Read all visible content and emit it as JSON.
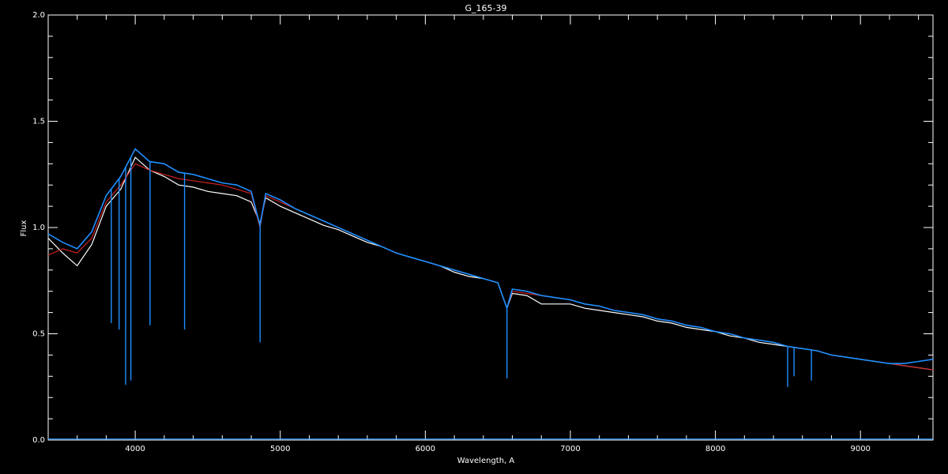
{
  "chart_data": {
    "type": "line",
    "title": "G_165-39",
    "xlabel": "Wavelength, A",
    "ylabel": "Flux",
    "xlim": [
      3400,
      9500
    ],
    "ylim": [
      0,
      2.0
    ],
    "xticks": [
      4000,
      5000,
      6000,
      7000,
      8000,
      9000
    ],
    "yticks": [
      0.0,
      0.5,
      1.0,
      1.5,
      2.0
    ],
    "ytick_labels": [
      "0.0",
      "0.5",
      "1.0",
      "1.5",
      "2.0"
    ],
    "grid": false,
    "background": "#000000",
    "axis_color": "#ffffff",
    "series": [
      {
        "color": "#ffffff",
        "x": [
          3400,
          3500,
          3600,
          3700,
          3800,
          3900,
          4000,
          4100,
          4200,
          4300,
          4400,
          4500,
          4600,
          4700,
          4800,
          4860,
          4900,
          5000,
          5100,
          5200,
          5300,
          5400,
          5500,
          5600,
          5700,
          5800,
          5900,
          6000,
          6100,
          6200,
          6300,
          6400,
          6500,
          6563,
          6600,
          6700,
          6800,
          6900,
          7000,
          7100,
          7200,
          7300,
          7400,
          7500,
          7600,
          7700,
          7800,
          7900,
          8000,
          8100,
          8200,
          8300,
          8400,
          8500,
          8600,
          8700,
          8800,
          8900,
          9000,
          9100,
          9200,
          9300,
          9400,
          9500
        ],
        "y": [
          0.95,
          0.88,
          0.82,
          0.92,
          1.1,
          1.18,
          1.33,
          1.27,
          1.24,
          1.2,
          1.19,
          1.17,
          1.16,
          1.15,
          1.12,
          1.02,
          1.14,
          1.1,
          1.07,
          1.04,
          1.01,
          0.99,
          0.96,
          0.93,
          0.91,
          0.88,
          0.86,
          0.84,
          0.82,
          0.79,
          0.77,
          0.76,
          0.74,
          0.62,
          0.69,
          0.68,
          0.64,
          0.64,
          0.64,
          0.62,
          0.61,
          0.6,
          0.59,
          0.58,
          0.56,
          0.55,
          0.53,
          0.52,
          0.51,
          0.49,
          0.48,
          0.46,
          0.45,
          0.44,
          0.43,
          0.42,
          0.4,
          0.39,
          0.38,
          0.37,
          0.36,
          0.35,
          0.34,
          0.33
        ]
      },
      {
        "color": "#cc2222",
        "x": [
          3400,
          3500,
          3600,
          3700,
          3800,
          3900,
          4000,
          4100,
          4200,
          4300,
          4400,
          4500,
          4600,
          4700,
          4800,
          4860,
          4900,
          5000,
          5100,
          5200,
          5300,
          5400,
          5500,
          5600,
          5700,
          5800,
          5900,
          6000,
          6100,
          6200,
          6300,
          6400,
          6500,
          6563,
          6600,
          6700,
          6800,
          6900,
          7000,
          7100,
          7200,
          7300,
          7400,
          7500,
          7600,
          7700,
          7800,
          7900,
          8000,
          8100,
          8200,
          8300,
          8400,
          8500,
          8600,
          8700,
          8800,
          8900,
          9000,
          9100,
          9200,
          9300,
          9400,
          9500
        ],
        "y": [
          0.87,
          0.9,
          0.88,
          0.95,
          1.12,
          1.2,
          1.3,
          1.27,
          1.25,
          1.23,
          1.22,
          1.21,
          1.2,
          1.18,
          1.16,
          1.0,
          1.15,
          1.12,
          1.09,
          1.06,
          1.03,
          1.0,
          0.97,
          0.94,
          0.91,
          0.88,
          0.86,
          0.84,
          0.82,
          0.8,
          0.78,
          0.76,
          0.74,
          0.62,
          0.7,
          0.69,
          0.68,
          0.67,
          0.66,
          0.64,
          0.63,
          0.61,
          0.6,
          0.59,
          0.57,
          0.56,
          0.54,
          0.53,
          0.51,
          0.5,
          0.48,
          0.47,
          0.46,
          0.44,
          0.43,
          0.42,
          0.4,
          0.39,
          0.38,
          0.37,
          0.36,
          0.35,
          0.34,
          0.33
        ]
      },
      {
        "color": "#1e8fff",
        "x": [
          3400,
          3500,
          3600,
          3700,
          3800,
          3900,
          4000,
          4100,
          4200,
          4300,
          4400,
          4500,
          4600,
          4700,
          4800,
          4860,
          4900,
          5000,
          5100,
          5200,
          5300,
          5400,
          5500,
          5600,
          5700,
          5800,
          5900,
          6000,
          6100,
          6200,
          6300,
          6400,
          6500,
          6563,
          6600,
          6700,
          6800,
          6900,
          7000,
          7100,
          7200,
          7300,
          7400,
          7500,
          7600,
          7700,
          7800,
          7900,
          8000,
          8100,
          8200,
          8300,
          8400,
          8500,
          8600,
          8700,
          8800,
          8900,
          9000,
          9100,
          9200,
          9300,
          9400,
          9500
        ],
        "y": [
          0.97,
          0.93,
          0.9,
          0.98,
          1.15,
          1.24,
          1.37,
          1.31,
          1.3,
          1.26,
          1.25,
          1.23,
          1.21,
          1.2,
          1.17,
          1.01,
          1.16,
          1.13,
          1.09,
          1.06,
          1.03,
          1.0,
          0.97,
          0.94,
          0.91,
          0.88,
          0.86,
          0.84,
          0.82,
          0.8,
          0.78,
          0.76,
          0.74,
          0.62,
          0.71,
          0.7,
          0.68,
          0.67,
          0.66,
          0.64,
          0.63,
          0.61,
          0.6,
          0.59,
          0.57,
          0.56,
          0.54,
          0.53,
          0.51,
          0.5,
          0.48,
          0.47,
          0.46,
          0.44,
          0.43,
          0.42,
          0.4,
          0.39,
          0.38,
          0.37,
          0.36,
          0.36,
          0.37,
          0.38
        ]
      },
      {
        "color": "#1e8fff",
        "x": [
          3400,
          4000,
          5000,
          6000,
          7000,
          8000,
          9000,
          9500
        ],
        "y": [
          0.005,
          0.005,
          0.005,
          0.005,
          0.005,
          0.005,
          0.005,
          0.005
        ]
      }
    ],
    "absorption_lines": [
      {
        "x": 3835,
        "depth_y": 0.55
      },
      {
        "x": 3889,
        "depth_y": 0.52
      },
      {
        "x": 3934,
        "depth_y": 0.26
      },
      {
        "x": 3970,
        "depth_y": 0.28
      },
      {
        "x": 4102,
        "depth_y": 0.54
      },
      {
        "x": 4340,
        "depth_y": 0.52
      },
      {
        "x": 4861,
        "depth_y": 0.46
      },
      {
        "x": 6563,
        "depth_y": 0.29
      },
      {
        "x": 8498,
        "depth_y": 0.25
      },
      {
        "x": 8542,
        "depth_y": 0.3
      },
      {
        "x": 8662,
        "depth_y": 0.28
      }
    ]
  }
}
